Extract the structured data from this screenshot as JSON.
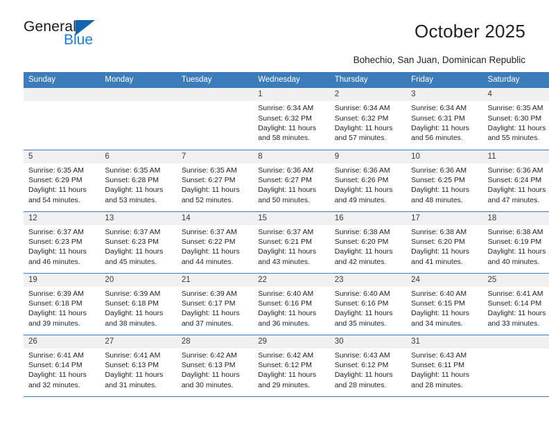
{
  "brand": {
    "name_part1": "General",
    "name_part2": "Blue"
  },
  "header": {
    "title": "October 2025",
    "location": "Bohechio, San Juan, Dominican Republic"
  },
  "calendar": {
    "weekday_headers": [
      "Sunday",
      "Monday",
      "Tuesday",
      "Wednesday",
      "Thursday",
      "Friday",
      "Saturday"
    ],
    "labels": {
      "sunrise": "Sunrise:",
      "sunset": "Sunset:",
      "daylight": "Daylight:"
    },
    "weeks": [
      [
        {
          "day": "",
          "empty": true
        },
        {
          "day": "",
          "empty": true
        },
        {
          "day": "",
          "empty": true
        },
        {
          "day": "1",
          "sunrise": "Sunrise: 6:34 AM",
          "sunset": "Sunset: 6:32 PM",
          "daylight1": "Daylight: 11 hours",
          "daylight2": "and 58 minutes."
        },
        {
          "day": "2",
          "sunrise": "Sunrise: 6:34 AM",
          "sunset": "Sunset: 6:32 PM",
          "daylight1": "Daylight: 11 hours",
          "daylight2": "and 57 minutes."
        },
        {
          "day": "3",
          "sunrise": "Sunrise: 6:34 AM",
          "sunset": "Sunset: 6:31 PM",
          "daylight1": "Daylight: 11 hours",
          "daylight2": "and 56 minutes."
        },
        {
          "day": "4",
          "sunrise": "Sunrise: 6:35 AM",
          "sunset": "Sunset: 6:30 PM",
          "daylight1": "Daylight: 11 hours",
          "daylight2": "and 55 minutes."
        }
      ],
      [
        {
          "day": "5",
          "sunrise": "Sunrise: 6:35 AM",
          "sunset": "Sunset: 6:29 PM",
          "daylight1": "Daylight: 11 hours",
          "daylight2": "and 54 minutes."
        },
        {
          "day": "6",
          "sunrise": "Sunrise: 6:35 AM",
          "sunset": "Sunset: 6:28 PM",
          "daylight1": "Daylight: 11 hours",
          "daylight2": "and 53 minutes."
        },
        {
          "day": "7",
          "sunrise": "Sunrise: 6:35 AM",
          "sunset": "Sunset: 6:27 PM",
          "daylight1": "Daylight: 11 hours",
          "daylight2": "and 52 minutes."
        },
        {
          "day": "8",
          "sunrise": "Sunrise: 6:36 AM",
          "sunset": "Sunset: 6:27 PM",
          "daylight1": "Daylight: 11 hours",
          "daylight2": "and 50 minutes."
        },
        {
          "day": "9",
          "sunrise": "Sunrise: 6:36 AM",
          "sunset": "Sunset: 6:26 PM",
          "daylight1": "Daylight: 11 hours",
          "daylight2": "and 49 minutes."
        },
        {
          "day": "10",
          "sunrise": "Sunrise: 6:36 AM",
          "sunset": "Sunset: 6:25 PM",
          "daylight1": "Daylight: 11 hours",
          "daylight2": "and 48 minutes."
        },
        {
          "day": "11",
          "sunrise": "Sunrise: 6:36 AM",
          "sunset": "Sunset: 6:24 PM",
          "daylight1": "Daylight: 11 hours",
          "daylight2": "and 47 minutes."
        }
      ],
      [
        {
          "day": "12",
          "sunrise": "Sunrise: 6:37 AM",
          "sunset": "Sunset: 6:23 PM",
          "daylight1": "Daylight: 11 hours",
          "daylight2": "and 46 minutes."
        },
        {
          "day": "13",
          "sunrise": "Sunrise: 6:37 AM",
          "sunset": "Sunset: 6:23 PM",
          "daylight1": "Daylight: 11 hours",
          "daylight2": "and 45 minutes."
        },
        {
          "day": "14",
          "sunrise": "Sunrise: 6:37 AM",
          "sunset": "Sunset: 6:22 PM",
          "daylight1": "Daylight: 11 hours",
          "daylight2": "and 44 minutes."
        },
        {
          "day": "15",
          "sunrise": "Sunrise: 6:37 AM",
          "sunset": "Sunset: 6:21 PM",
          "daylight1": "Daylight: 11 hours",
          "daylight2": "and 43 minutes."
        },
        {
          "day": "16",
          "sunrise": "Sunrise: 6:38 AM",
          "sunset": "Sunset: 6:20 PM",
          "daylight1": "Daylight: 11 hours",
          "daylight2": "and 42 minutes."
        },
        {
          "day": "17",
          "sunrise": "Sunrise: 6:38 AM",
          "sunset": "Sunset: 6:20 PM",
          "daylight1": "Daylight: 11 hours",
          "daylight2": "and 41 minutes."
        },
        {
          "day": "18",
          "sunrise": "Sunrise: 6:38 AM",
          "sunset": "Sunset: 6:19 PM",
          "daylight1": "Daylight: 11 hours",
          "daylight2": "and 40 minutes."
        }
      ],
      [
        {
          "day": "19",
          "sunrise": "Sunrise: 6:39 AM",
          "sunset": "Sunset: 6:18 PM",
          "daylight1": "Daylight: 11 hours",
          "daylight2": "and 39 minutes."
        },
        {
          "day": "20",
          "sunrise": "Sunrise: 6:39 AM",
          "sunset": "Sunset: 6:18 PM",
          "daylight1": "Daylight: 11 hours",
          "daylight2": "and 38 minutes."
        },
        {
          "day": "21",
          "sunrise": "Sunrise: 6:39 AM",
          "sunset": "Sunset: 6:17 PM",
          "daylight1": "Daylight: 11 hours",
          "daylight2": "and 37 minutes."
        },
        {
          "day": "22",
          "sunrise": "Sunrise: 6:40 AM",
          "sunset": "Sunset: 6:16 PM",
          "daylight1": "Daylight: 11 hours",
          "daylight2": "and 36 minutes."
        },
        {
          "day": "23",
          "sunrise": "Sunrise: 6:40 AM",
          "sunset": "Sunset: 6:16 PM",
          "daylight1": "Daylight: 11 hours",
          "daylight2": "and 35 minutes."
        },
        {
          "day": "24",
          "sunrise": "Sunrise: 6:40 AM",
          "sunset": "Sunset: 6:15 PM",
          "daylight1": "Daylight: 11 hours",
          "daylight2": "and 34 minutes."
        },
        {
          "day": "25",
          "sunrise": "Sunrise: 6:41 AM",
          "sunset": "Sunset: 6:14 PM",
          "daylight1": "Daylight: 11 hours",
          "daylight2": "and 33 minutes."
        }
      ],
      [
        {
          "day": "26",
          "sunrise": "Sunrise: 6:41 AM",
          "sunset": "Sunset: 6:14 PM",
          "daylight1": "Daylight: 11 hours",
          "daylight2": "and 32 minutes."
        },
        {
          "day": "27",
          "sunrise": "Sunrise: 6:41 AM",
          "sunset": "Sunset: 6:13 PM",
          "daylight1": "Daylight: 11 hours",
          "daylight2": "and 31 minutes."
        },
        {
          "day": "28",
          "sunrise": "Sunrise: 6:42 AM",
          "sunset": "Sunset: 6:13 PM",
          "daylight1": "Daylight: 11 hours",
          "daylight2": "and 30 minutes."
        },
        {
          "day": "29",
          "sunrise": "Sunrise: 6:42 AM",
          "sunset": "Sunset: 6:12 PM",
          "daylight1": "Daylight: 11 hours",
          "daylight2": "and 29 minutes."
        },
        {
          "day": "30",
          "sunrise": "Sunrise: 6:43 AM",
          "sunset": "Sunset: 6:12 PM",
          "daylight1": "Daylight: 11 hours",
          "daylight2": "and 28 minutes."
        },
        {
          "day": "31",
          "sunrise": "Sunrise: 6:43 AM",
          "sunset": "Sunset: 6:11 PM",
          "daylight1": "Daylight: 11 hours",
          "daylight2": "and 28 minutes."
        },
        {
          "day": "",
          "empty": true
        }
      ]
    ]
  },
  "colors": {
    "header_blue": "#3d7cbb",
    "logo_blue": "#1a7fd4",
    "daynum_band": "#f0f0f0"
  }
}
